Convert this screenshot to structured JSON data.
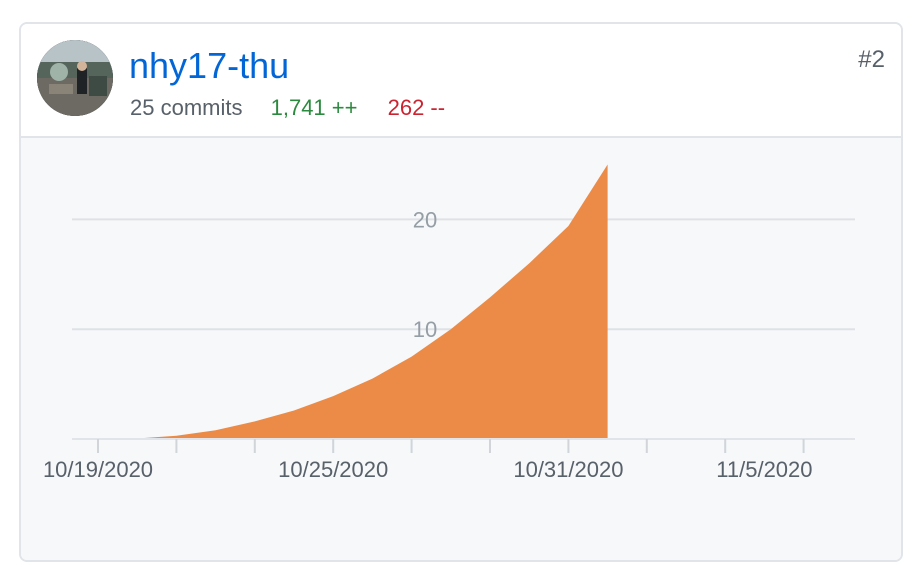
{
  "contributor": {
    "username": "nhy17-thu",
    "commits": "25 commits",
    "additions": "1,741 ++",
    "deletions": "262 --",
    "rank": "#2"
  },
  "colors": {
    "link": "#0366d6",
    "additions": "#2c8a3f",
    "deletions": "#cb2431",
    "area_fill": "#eb8b47"
  },
  "icons": {
    "avatar": "user-avatar-photo"
  },
  "chart_data": {
    "type": "area",
    "x_ticks": [
      "10/19/2020",
      "10/25/2020",
      "10/31/2020",
      "11/5/2020"
    ],
    "y_ticks": [
      10,
      20
    ],
    "ylim": [
      0,
      25
    ],
    "grid": true,
    "series": [
      {
        "x": [
          "10/19/2020",
          "10/20/2020",
          "10/21/2020",
          "10/22/2020",
          "10/23/2020",
          "10/24/2020",
          "10/25/2020",
          "10/26/2020",
          "10/27/2020",
          "10/28/2020",
          "10/29/2020",
          "10/30/2020",
          "10/31/2020",
          "11/1/2020"
        ],
        "values": [
          0,
          0.05,
          0.3,
          0.8,
          1.6,
          2.6,
          3.9,
          5.5,
          7.5,
          10,
          12.9,
          16,
          19.4,
          25
        ]
      }
    ]
  }
}
